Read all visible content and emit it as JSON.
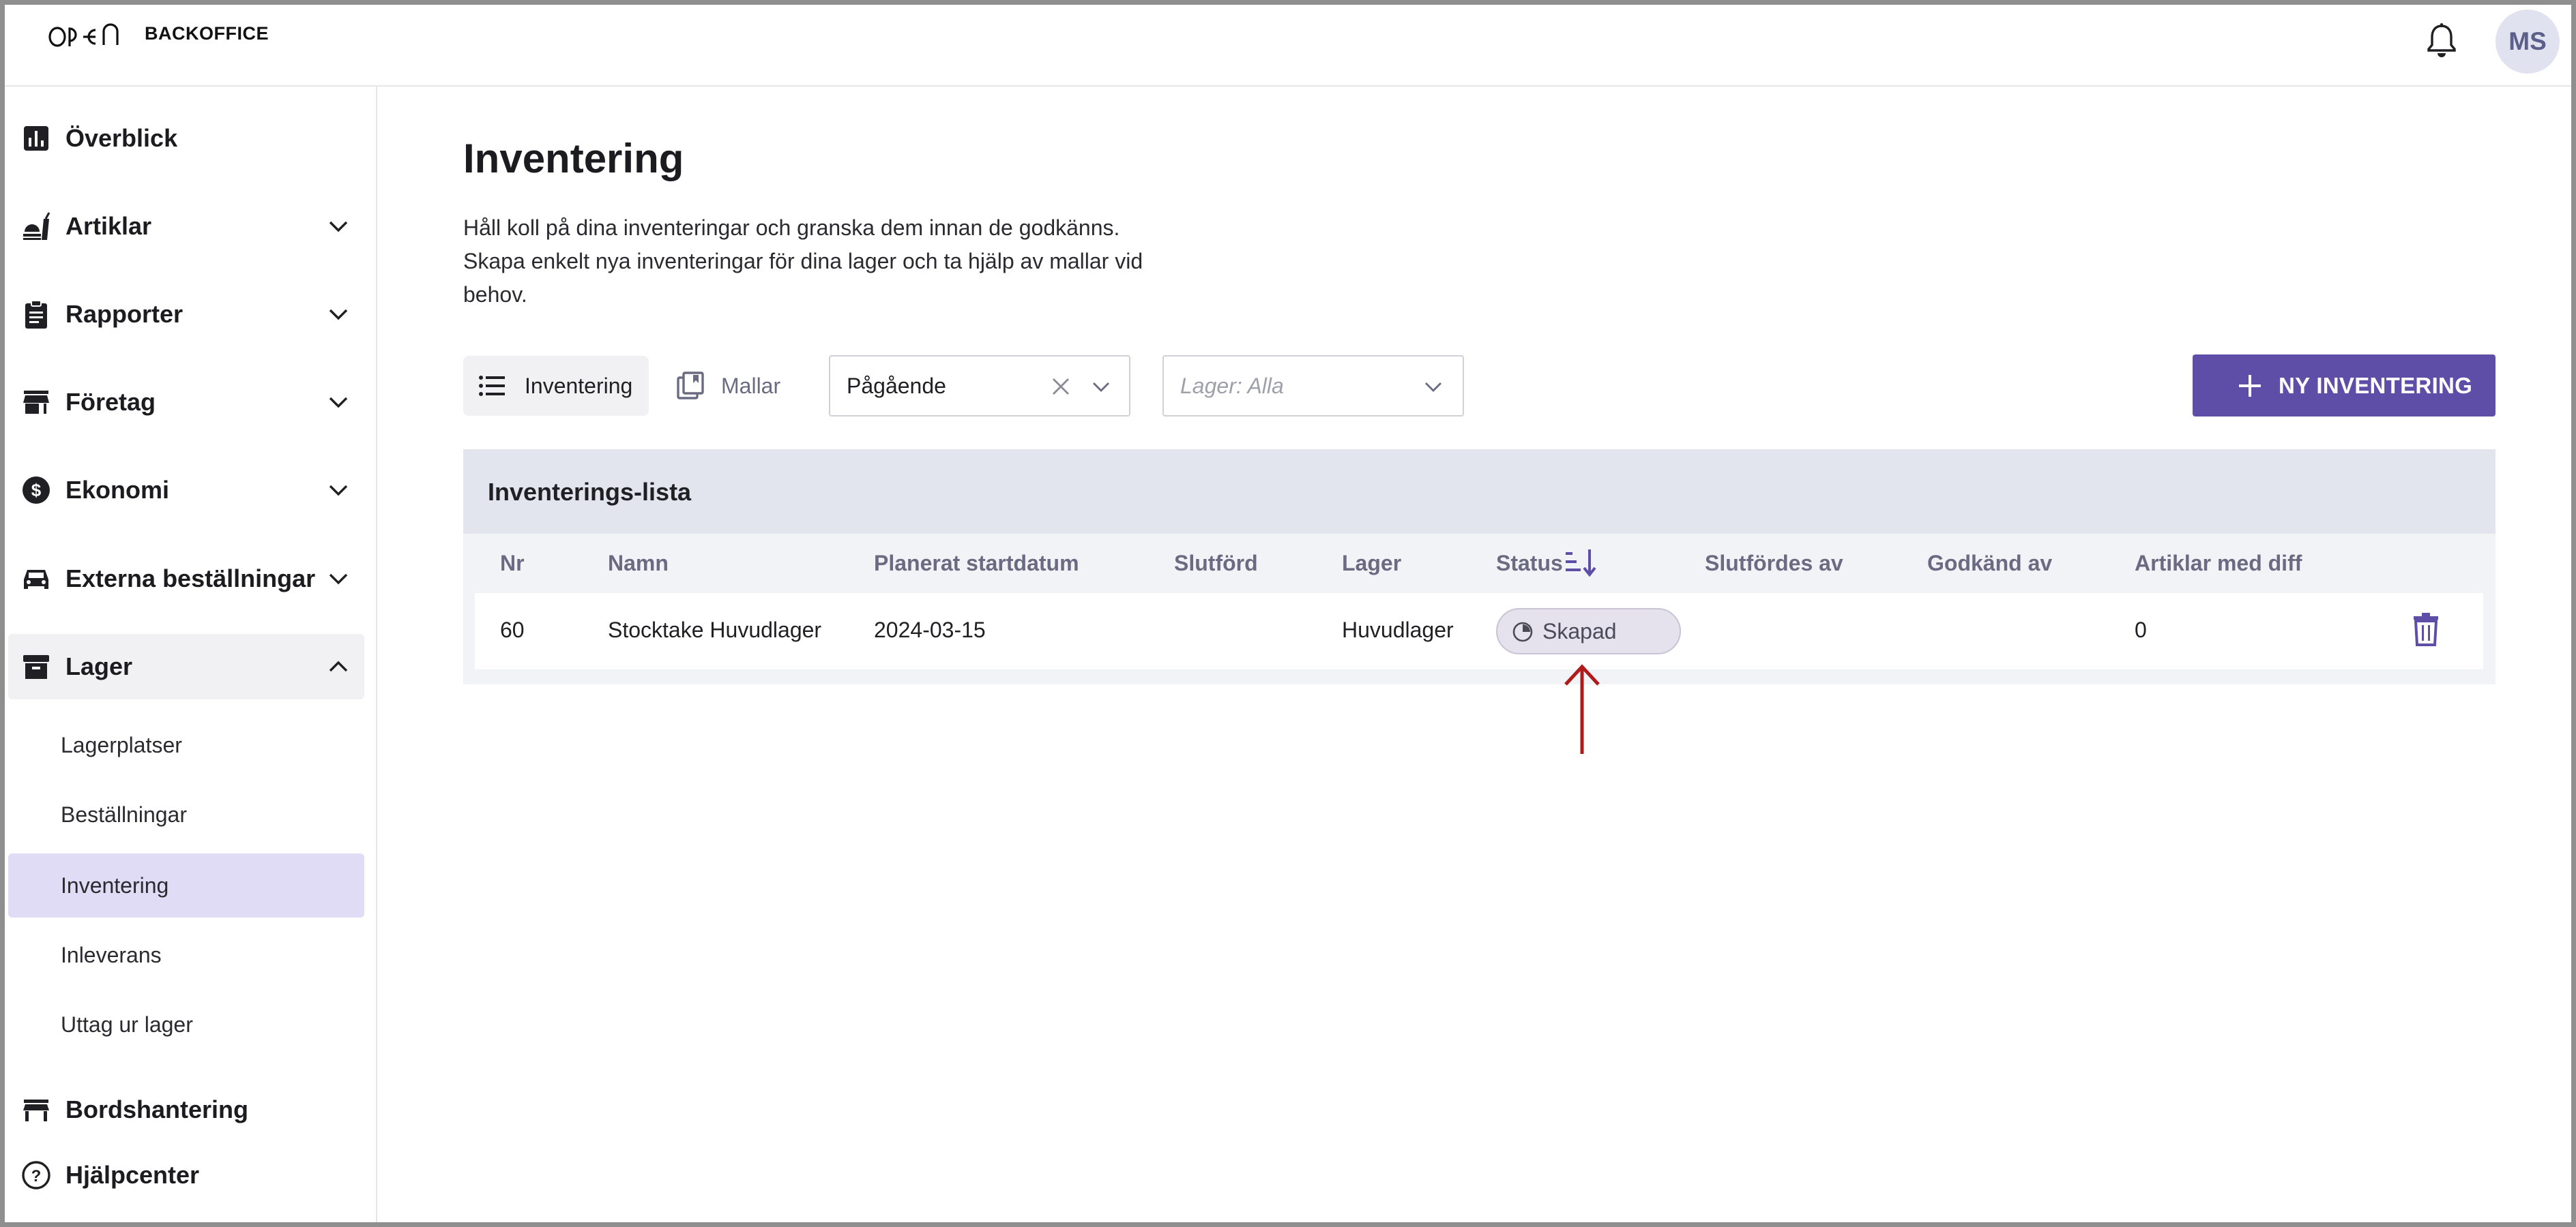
{
  "header": {
    "logo_text": "OPEN",
    "product_name": "BACKOFFICE",
    "avatar_initials": "MS"
  },
  "sidebar": {
    "items": [
      {
        "label": "Överblick",
        "icon": "bar-chart-icon"
      },
      {
        "label": "Artiklar",
        "icon": "food-icon"
      },
      {
        "label": "Rapporter",
        "icon": "clipboard-icon"
      },
      {
        "label": "Företag",
        "icon": "store-icon"
      },
      {
        "label": "Ekonomi",
        "icon": "dollar-icon"
      },
      {
        "label": "Externa beställningar",
        "icon": "car-icon"
      },
      {
        "label": "Lager",
        "icon": "archive-box-icon"
      },
      {
        "label": "Bordshantering",
        "icon": "table-icon"
      },
      {
        "label": "Hjälpcenter",
        "icon": "help-circle-icon"
      }
    ],
    "lager_subitems": [
      "Lagerplatser",
      "Beställningar",
      "Inventering",
      "Inleverans",
      "Uttag ur lager"
    ],
    "selected_subitem": "Inventering"
  },
  "main": {
    "title": "Inventering",
    "description_lines": [
      "Håll koll på dina inventeringar och granska dem innan de godkänns.",
      "Skapa enkelt nya inventeringar för dina lager och ta hjälp av mallar vid",
      "behov."
    ],
    "tabs": [
      {
        "label": "Inventering",
        "active": true
      },
      {
        "label": "Mallar",
        "active": false
      }
    ],
    "status_filter": {
      "value": "Pågående"
    },
    "warehouse_filter": {
      "placeholder": "Lager: Alla"
    },
    "new_button_label": "NY INVENTERING"
  },
  "table": {
    "title": "Inventerings-lista",
    "columns": [
      "Nr",
      "Namn",
      "Planerat startdatum",
      "Slutförd",
      "Lager",
      "Status",
      "Slutfördes av",
      "Godkänd av",
      "Artiklar med diff"
    ],
    "rows": [
      {
        "nr": "60",
        "namn": "Stocktake Huvudlager",
        "planerat_startdatum": "2024-03-15",
        "slutford": "",
        "lager": "Huvudlager",
        "status": "Skapad",
        "slutfordes_av": "",
        "godkand_av": "",
        "artiklar_med_diff": "0"
      }
    ]
  },
  "colors": {
    "primary": "#5f4ea8",
    "selected_nav": "#e1dcf6",
    "annotation_arrow": "#b01a1a"
  }
}
